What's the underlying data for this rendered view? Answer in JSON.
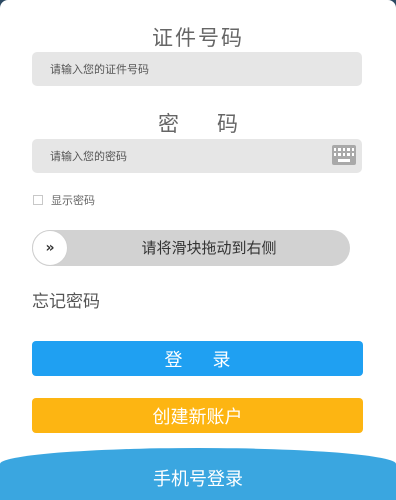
{
  "login_form": {
    "id_heading": "证件号码",
    "id_placeholder": "请输入您的证件号码",
    "password_heading": "密码",
    "password_placeholder": "请输入您的密码",
    "keyboard_icon": "keyboard-icon",
    "show_password_label": "显示密码",
    "show_password_checked": false,
    "slider_text": "请将滑块拖动到右侧",
    "slider_handle_glyph": "»",
    "forgot_password": "忘记密码",
    "login_button": "登录",
    "create_account_button": "创建新账户",
    "phone_login": "手机号登录"
  },
  "colors": {
    "primary": "#1fa0f2",
    "secondary": "#fdb512",
    "bottom_bar": "#3aa6e0"
  }
}
